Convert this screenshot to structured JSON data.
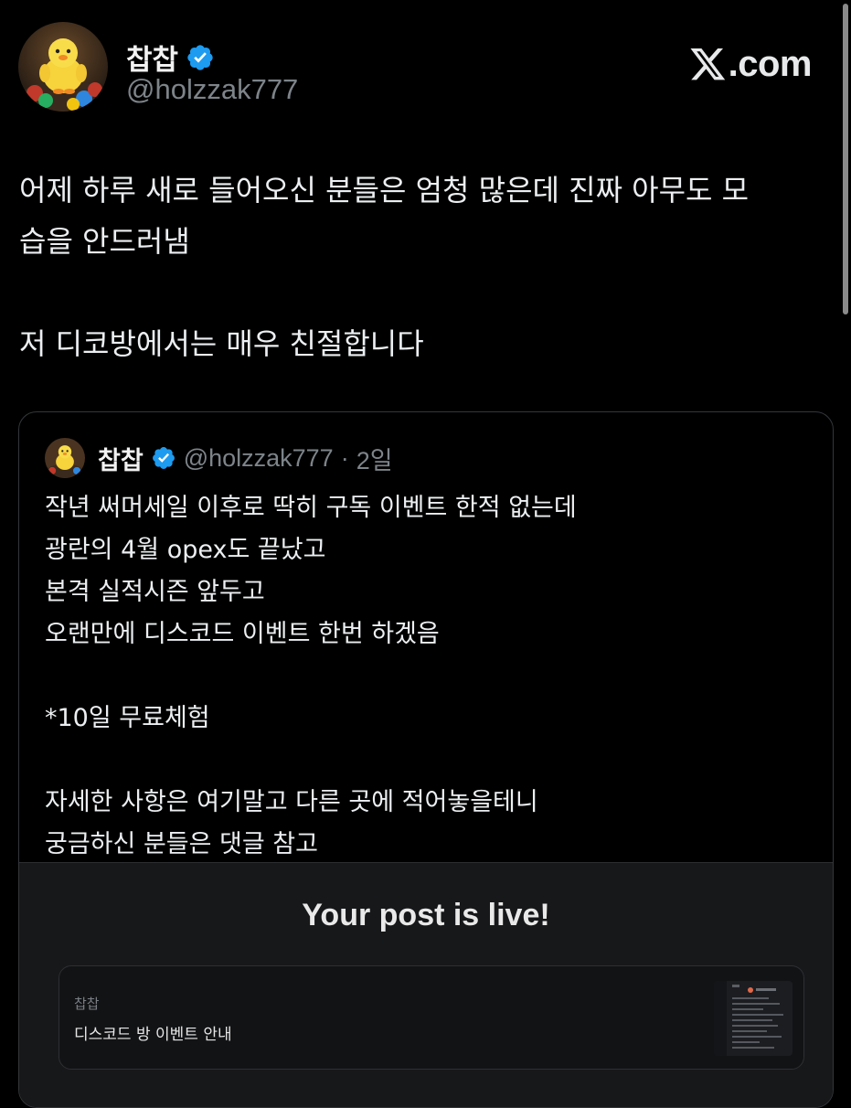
{
  "author": {
    "display_name": "찹찹",
    "handle": "@holzzak777",
    "verified_icon": "verified-badge-icon",
    "badge_color": "#1d9bf0"
  },
  "brand": {
    "logo_icon": "x-logo-icon",
    "text": ".com"
  },
  "post": {
    "lines": [
      "어제 하루 새로 들어오신 분들은 엄청 많은데 진짜 아무도 모",
      "습을 안드러냄",
      "저 디코방에서는 매우 친절합니다"
    ]
  },
  "quoted": {
    "display_name": "찹찹",
    "handle": "@holzzak777",
    "dot": "·",
    "time": "2일",
    "lines": [
      "작년 써머세일 이후로 딱히 구독 이벤트 한적 없는데",
      "광란의 4월 opex도 끝났고",
      "본격 실적시즌 앞두고",
      "오랜만에 디스코드 이벤트 한번 하겠음",
      "*10일 무료체험",
      "자세한 사항은 여기말고 다른 곳에 적어놓을테니",
      "궁금하신 분들은 댓글 참고"
    ],
    "card": {
      "title": "Your post is live!",
      "preview_author": "찹찹",
      "preview_title": "디스코드 방 이벤트 안내"
    }
  }
}
